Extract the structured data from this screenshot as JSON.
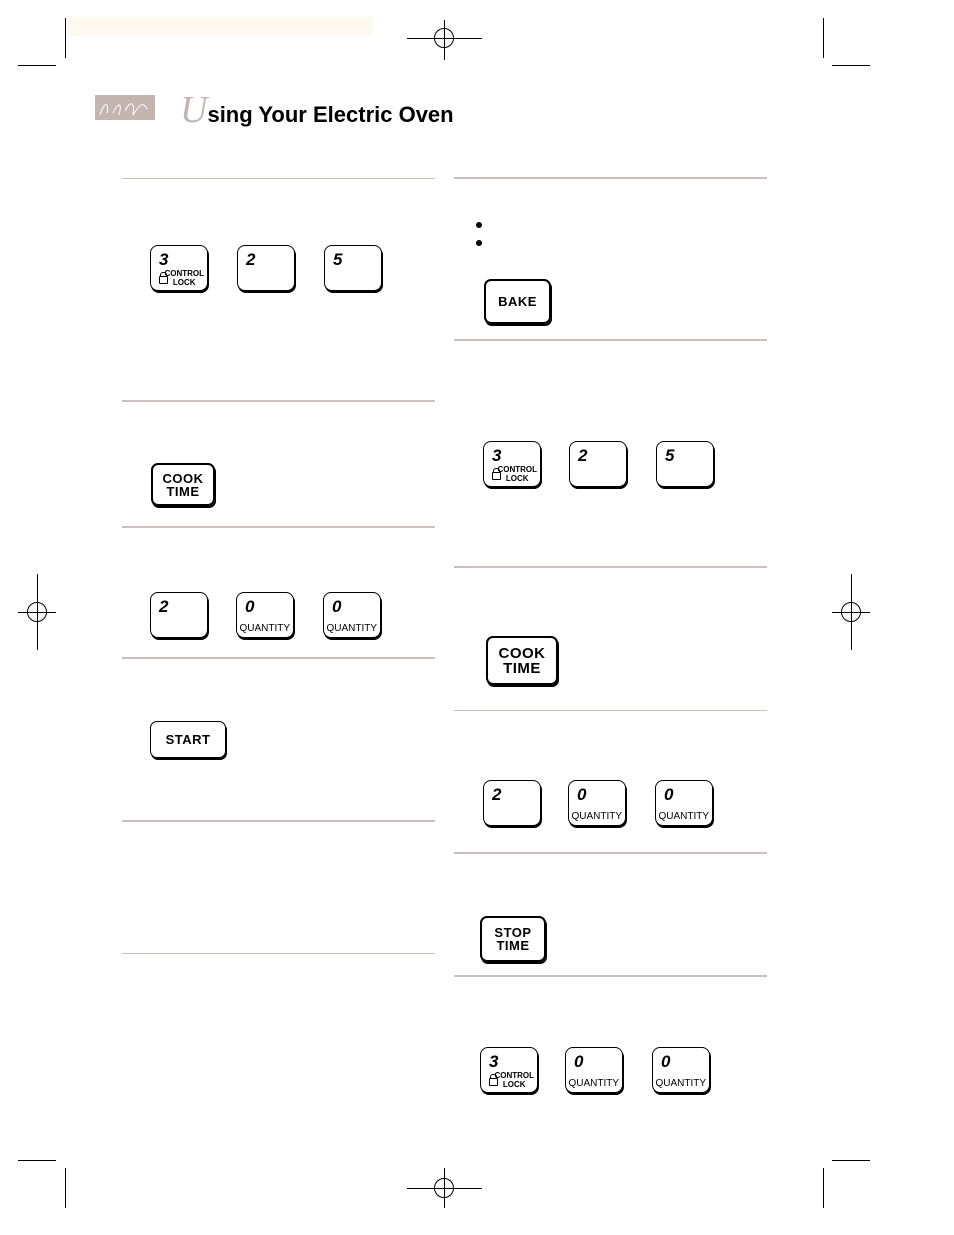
{
  "header": {
    "title_initial": "U",
    "title_rest": "sing Your Electric Oven",
    "logo": "signature logo",
    "accent_color": "#c4b5b1"
  },
  "left_column": [
    {
      "type": "keys",
      "keys": [
        {
          "num": "3",
          "label": "CONTROL LOCK",
          "lock": true
        },
        {
          "num": "2"
        },
        {
          "num": "5"
        }
      ]
    },
    {
      "type": "button",
      "label_lines": [
        "COOK",
        "TIME"
      ]
    },
    {
      "type": "keys",
      "keys": [
        {
          "num": "2"
        },
        {
          "num": "0",
          "label": "QUANTITY"
        },
        {
          "num": "0",
          "label": "QUANTITY"
        }
      ]
    },
    {
      "type": "button",
      "label_lines": [
        "START"
      ]
    }
  ],
  "right_column": [
    {
      "type": "button",
      "label_lines": [
        "BAKE"
      ]
    },
    {
      "type": "keys",
      "keys": [
        {
          "num": "3",
          "label": "CONTROL LOCK",
          "lock": true
        },
        {
          "num": "2"
        },
        {
          "num": "5"
        }
      ]
    },
    {
      "type": "button",
      "label_lines": [
        "COOK",
        "TIME"
      ]
    },
    {
      "type": "keys",
      "keys": [
        {
          "num": "2"
        },
        {
          "num": "0",
          "label": "QUANTITY"
        },
        {
          "num": "0",
          "label": "QUANTITY"
        }
      ]
    },
    {
      "type": "button",
      "label_lines": [
        "STOP",
        "TIME"
      ]
    },
    {
      "type": "keys",
      "keys": [
        {
          "num": "3",
          "label": "CONTROL LOCK",
          "lock": true
        },
        {
          "num": "0",
          "label": "QUANTITY"
        },
        {
          "num": "0",
          "label": "QUANTITY"
        }
      ]
    }
  ]
}
